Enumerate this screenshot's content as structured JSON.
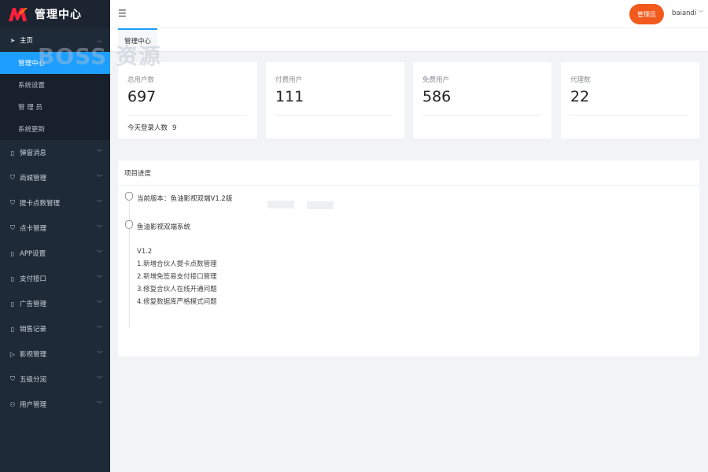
{
  "app": {
    "title": "管理中心"
  },
  "sidebar": {
    "home_label": "主页",
    "home_sub": [
      {
        "label": "管理中心",
        "active": true
      },
      {
        "label": "系统设置",
        "active": false
      },
      {
        "label": "管 理 员",
        "active": false
      },
      {
        "label": "系统更新",
        "active": false
      }
    ],
    "items": [
      {
        "label": "弹窗消息",
        "icon": "phone-icon"
      },
      {
        "label": "商城管理",
        "icon": "shield-icon"
      },
      {
        "label": "提卡点数管理",
        "icon": "shield-icon"
      },
      {
        "label": "点卡管理",
        "icon": "shield-icon"
      },
      {
        "label": "APP设置",
        "icon": "phone-icon"
      },
      {
        "label": "支付接口",
        "icon": "phone-icon"
      },
      {
        "label": "广告管理",
        "icon": "phone-icon"
      },
      {
        "label": "销售记录",
        "icon": "phone-icon"
      },
      {
        "label": "影视管理",
        "icon": "play-icon"
      },
      {
        "label": "五级分润",
        "icon": "shield-icon"
      },
      {
        "label": "用户管理",
        "icon": "user-icon"
      }
    ]
  },
  "header": {
    "role_button": "管理员",
    "username": "baiandi"
  },
  "tabs": [
    {
      "label": "管理中心"
    }
  ],
  "stats": [
    {
      "label": "总用户数",
      "value": "697",
      "extra_label": "今天登录人数",
      "extra_value": "9"
    },
    {
      "label": "付费用户",
      "value": "111"
    },
    {
      "label": "免费用户",
      "value": "586"
    },
    {
      "label": "代理数",
      "value": "22"
    }
  ],
  "progress": {
    "title": "项目进度",
    "version_line": "当前版本：鱼油影视双端V1.2版",
    "system_name": "鱼油影视双端系统",
    "notes": [
      "V1.2",
      "1.新增合伙人提卡点数管理",
      "2.新增免签易支付接口管理",
      "3.修复合伙人在线开通问题",
      "4.修复数据库严格模式问题"
    ]
  },
  "watermark": "BOSS 资源",
  "colors": {
    "sidebar": "#1f2a38",
    "accent": "#1e9fff",
    "role_button": "#f25a1d"
  }
}
